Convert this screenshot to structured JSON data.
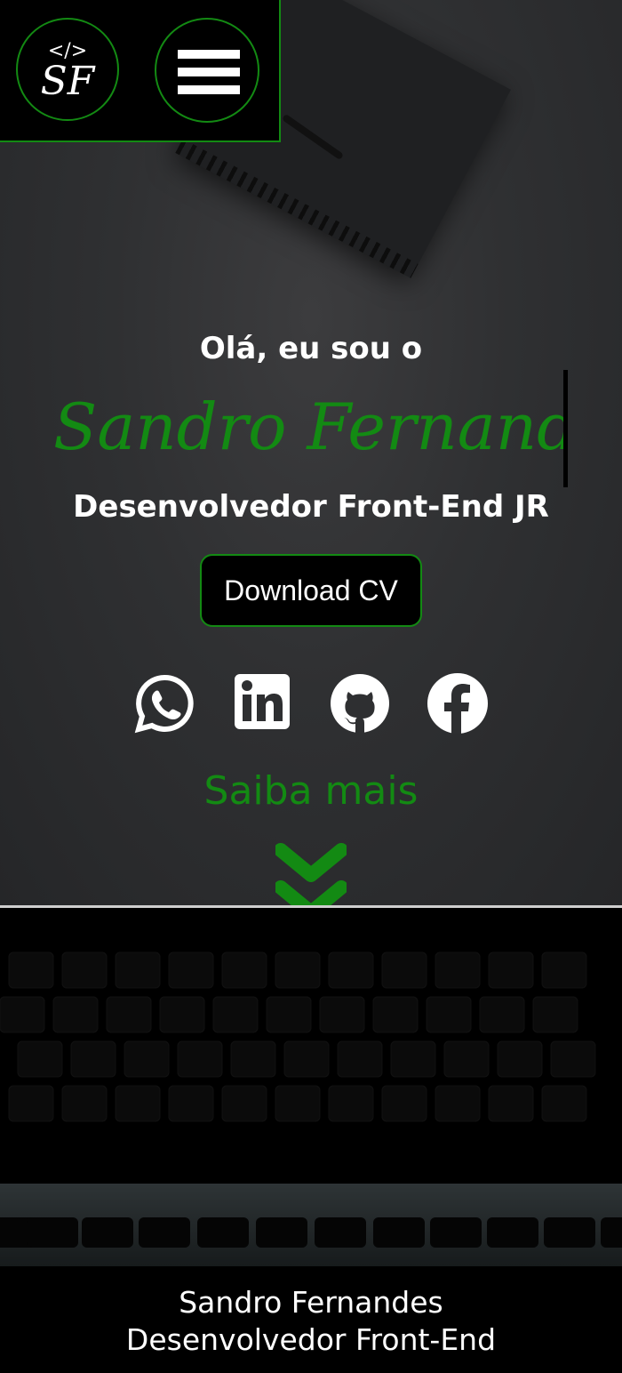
{
  "header": {
    "logo": {
      "code_text": "</>",
      "letters": "SF"
    },
    "menu_icon": "hamburger-menu-icon"
  },
  "hero": {
    "greeting": "Olá, eu sou o",
    "name": "Sandro Fernandes",
    "role": "Desenvolvedor Front-End JR",
    "cv_button": "Download CV",
    "social": [
      "whatsapp-icon",
      "linkedin-icon",
      "github-icon",
      "facebook-icon"
    ],
    "more_label": "Saiba mais",
    "more_icon": "double-chevron-down-icon"
  },
  "footer": {
    "line1": "Sandro Fernandes",
    "line2": "Desenvolvedor Front-End"
  },
  "colors": {
    "accent": "#138a13",
    "background": "#000000",
    "text": "#ffffff"
  }
}
